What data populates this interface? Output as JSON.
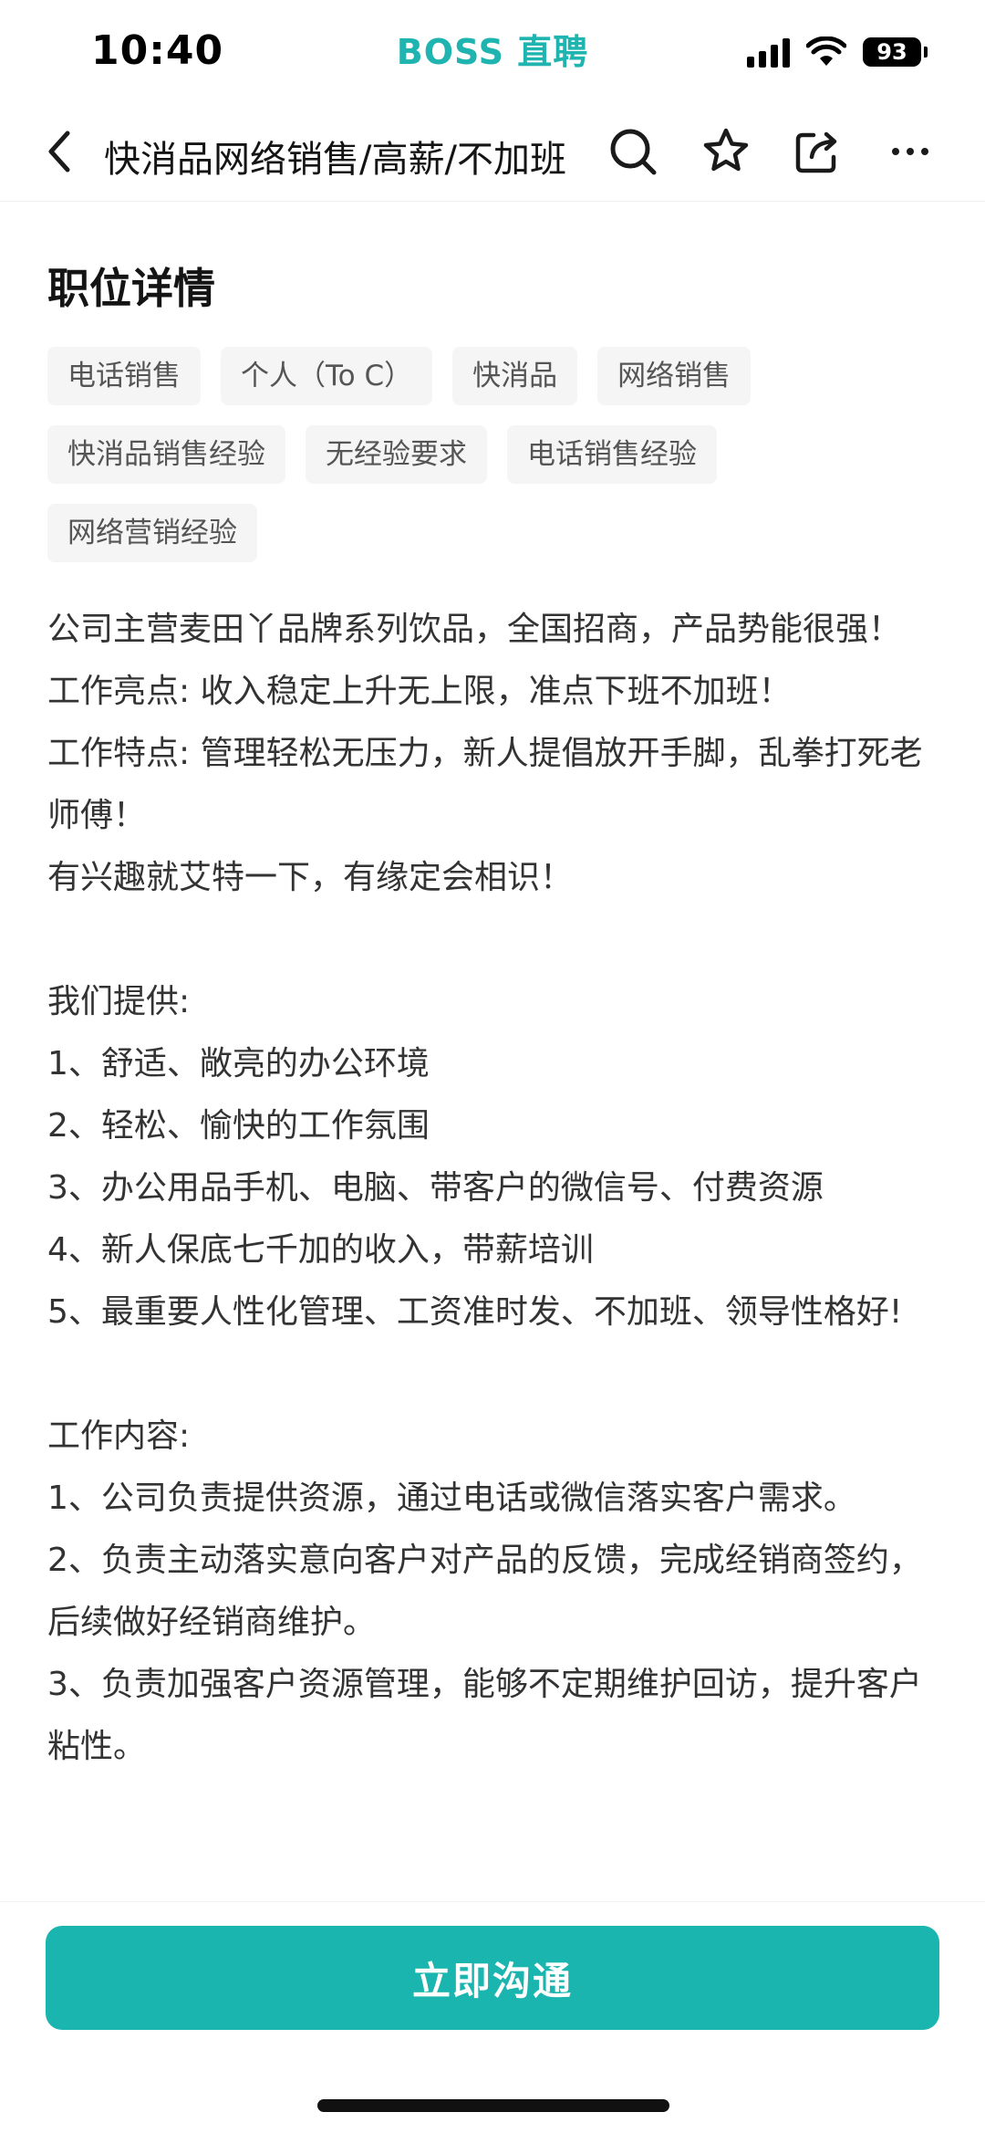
{
  "status_bar": {
    "time": "10:40",
    "brand": "BOSS 直聘",
    "battery": "93",
    "icons": [
      "signal-icon",
      "wifi-icon",
      "battery-icon"
    ]
  },
  "nav": {
    "title": "快消品网络销售/高薪/不加班",
    "icons": [
      "back-icon",
      "search-icon",
      "star-icon",
      "share-icon",
      "more-icon"
    ]
  },
  "section": {
    "title": "职位详情"
  },
  "tags": [
    "电话销售",
    "个人（To C）",
    "快消品",
    "网络销售",
    "快消品销售经验",
    "无经验要求",
    "电话销售经验",
    "网络营销经验"
  ],
  "description": "公司主营麦田丫品牌系列饮品，全国招商，产品势能很强！\n工作亮点: 收入稳定上升无上限，准点下班不加班！\n工作特点: 管理轻松无压力，新人提倡放开手脚，乱拳打死老师傅！\n有兴趣就艾特一下，有缘定会相识！\n\n我们提供:\n1、舒适、敞亮的办公环境\n2、轻松、愉快的工作氛围\n3、办公用品手机、电脑、带客户的微信号、付费资源\n4、新人保底七千加的收入，带薪培训\n5、最重要人性化管理、工资准时发、不加班、领导性格好!\n\n工作内容:\n1、公司负责提供资源，通过电话或微信落实客户需求。\n2、负责主动落实意向客户对产品的反馈，完成经销商签约，后续做好经销商维护。\n3、负责加强客户资源管理，能够不定期维护回访，提升客户粘性。",
  "bottom": {
    "chat_button": "立即沟通"
  },
  "colors": {
    "brand": "#1fb4b0",
    "button": "#1bb5b0",
    "tag_bg": "#f5f5f5"
  }
}
